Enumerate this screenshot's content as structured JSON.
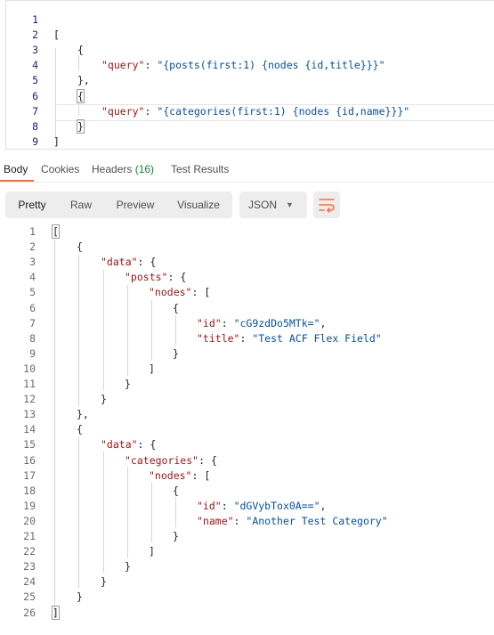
{
  "request_editor": {
    "lines": [
      {
        "num": "1",
        "tokens": []
      },
      {
        "num": "2",
        "tokens": [
          {
            "t": "[",
            "c": "p"
          }
        ]
      },
      {
        "num": "3",
        "tokens": [
          {
            "t": "{",
            "c": "p"
          }
        ]
      },
      {
        "num": "4",
        "tokens": [
          {
            "t": "\"query\"",
            "c": "k"
          },
          {
            "t": ": ",
            "c": "p"
          },
          {
            "t": "\"{posts(first:1) {nodes {id,title}}}\"",
            "c": "s"
          }
        ]
      },
      {
        "num": "5",
        "tokens": [
          {
            "t": "},",
            "c": "p"
          }
        ]
      },
      {
        "num": "6",
        "tokens": [
          {
            "t": "{",
            "c": "p"
          }
        ]
      },
      {
        "num": "7",
        "tokens": [
          {
            "t": "\"query\"",
            "c": "k"
          },
          {
            "t": ": ",
            "c": "p"
          },
          {
            "t": "\"{categories(first:1) {nodes {id,name}}}\"",
            "c": "s"
          }
        ]
      },
      {
        "num": "8",
        "tokens": [
          {
            "t": "}",
            "c": "p"
          }
        ]
      },
      {
        "num": "9",
        "tokens": [
          {
            "t": "]",
            "c": "p"
          }
        ]
      }
    ]
  },
  "tabs": {
    "body": "Body",
    "cookies": "Cookies",
    "headers": "Headers",
    "headers_count": "(16)",
    "test_results": "Test Results"
  },
  "toolbar": {
    "pretty": "Pretty",
    "raw": "Raw",
    "preview": "Preview",
    "visualize": "Visualize",
    "format": "JSON"
  },
  "response": {
    "lines": [
      {
        "num": "1",
        "tokens": [
          {
            "t": "[",
            "c": "p"
          }
        ]
      },
      {
        "num": "2",
        "tokens": [
          {
            "t": "{",
            "c": "p"
          }
        ]
      },
      {
        "num": "3",
        "tokens": [
          {
            "t": "\"data\"",
            "c": "k"
          },
          {
            "t": ": {",
            "c": "p"
          }
        ]
      },
      {
        "num": "4",
        "tokens": [
          {
            "t": "\"posts\"",
            "c": "k"
          },
          {
            "t": ": {",
            "c": "p"
          }
        ]
      },
      {
        "num": "5",
        "tokens": [
          {
            "t": "\"nodes\"",
            "c": "k"
          },
          {
            "t": ": [",
            "c": "p"
          }
        ]
      },
      {
        "num": "6",
        "tokens": [
          {
            "t": "{",
            "c": "p"
          }
        ]
      },
      {
        "num": "7",
        "tokens": [
          {
            "t": "\"id\"",
            "c": "k"
          },
          {
            "t": ": ",
            "c": "p"
          },
          {
            "t": "\"cG9zdDo5MTk=\"",
            "c": "s"
          },
          {
            "t": ",",
            "c": "p"
          }
        ]
      },
      {
        "num": "8",
        "tokens": [
          {
            "t": "\"title\"",
            "c": "k"
          },
          {
            "t": ": ",
            "c": "p"
          },
          {
            "t": "\"Test ACF Flex Field\"",
            "c": "s"
          }
        ]
      },
      {
        "num": "9",
        "tokens": [
          {
            "t": "}",
            "c": "p"
          }
        ]
      },
      {
        "num": "10",
        "tokens": [
          {
            "t": "]",
            "c": "p"
          }
        ]
      },
      {
        "num": "11",
        "tokens": [
          {
            "t": "}",
            "c": "p"
          }
        ]
      },
      {
        "num": "12",
        "tokens": [
          {
            "t": "}",
            "c": "p"
          }
        ]
      },
      {
        "num": "13",
        "tokens": [
          {
            "t": "},",
            "c": "p"
          }
        ]
      },
      {
        "num": "14",
        "tokens": [
          {
            "t": "{",
            "c": "p"
          }
        ]
      },
      {
        "num": "15",
        "tokens": [
          {
            "t": "\"data\"",
            "c": "k"
          },
          {
            "t": ": {",
            "c": "p"
          }
        ]
      },
      {
        "num": "16",
        "tokens": [
          {
            "t": "\"categories\"",
            "c": "k"
          },
          {
            "t": ": {",
            "c": "p"
          }
        ]
      },
      {
        "num": "17",
        "tokens": [
          {
            "t": "\"nodes\"",
            "c": "k"
          },
          {
            "t": ": [",
            "c": "p"
          }
        ]
      },
      {
        "num": "18",
        "tokens": [
          {
            "t": "{",
            "c": "p"
          }
        ]
      },
      {
        "num": "19",
        "tokens": [
          {
            "t": "\"id\"",
            "c": "k"
          },
          {
            "t": ": ",
            "c": "p"
          },
          {
            "t": "\"dGVybTox0A==\"",
            "c": "s"
          },
          {
            "t": ",",
            "c": "p"
          }
        ]
      },
      {
        "num": "20",
        "tokens": [
          {
            "t": "\"name\"",
            "c": "k"
          },
          {
            "t": ": ",
            "c": "p"
          },
          {
            "t": "\"Another Test Category\"",
            "c": "s"
          }
        ]
      },
      {
        "num": "21",
        "tokens": [
          {
            "t": "}",
            "c": "p"
          }
        ]
      },
      {
        "num": "22",
        "tokens": [
          {
            "t": "]",
            "c": "p"
          }
        ]
      },
      {
        "num": "23",
        "tokens": [
          {
            "t": "}",
            "c": "p"
          }
        ]
      },
      {
        "num": "24",
        "tokens": [
          {
            "t": "}",
            "c": "p"
          }
        ]
      },
      {
        "num": "25",
        "tokens": [
          {
            "t": "}",
            "c": "p"
          }
        ]
      },
      {
        "num": "26",
        "tokens": [
          {
            "t": "]",
            "c": "p"
          }
        ]
      }
    ]
  },
  "colors": {
    "accent": "#ff6c37",
    "key": "#a31515",
    "string": "#0451a5",
    "count": "#0b8a34"
  },
  "icons": {
    "dropdown": "chevron-down-icon",
    "wrap": "wrap-lines-icon"
  }
}
